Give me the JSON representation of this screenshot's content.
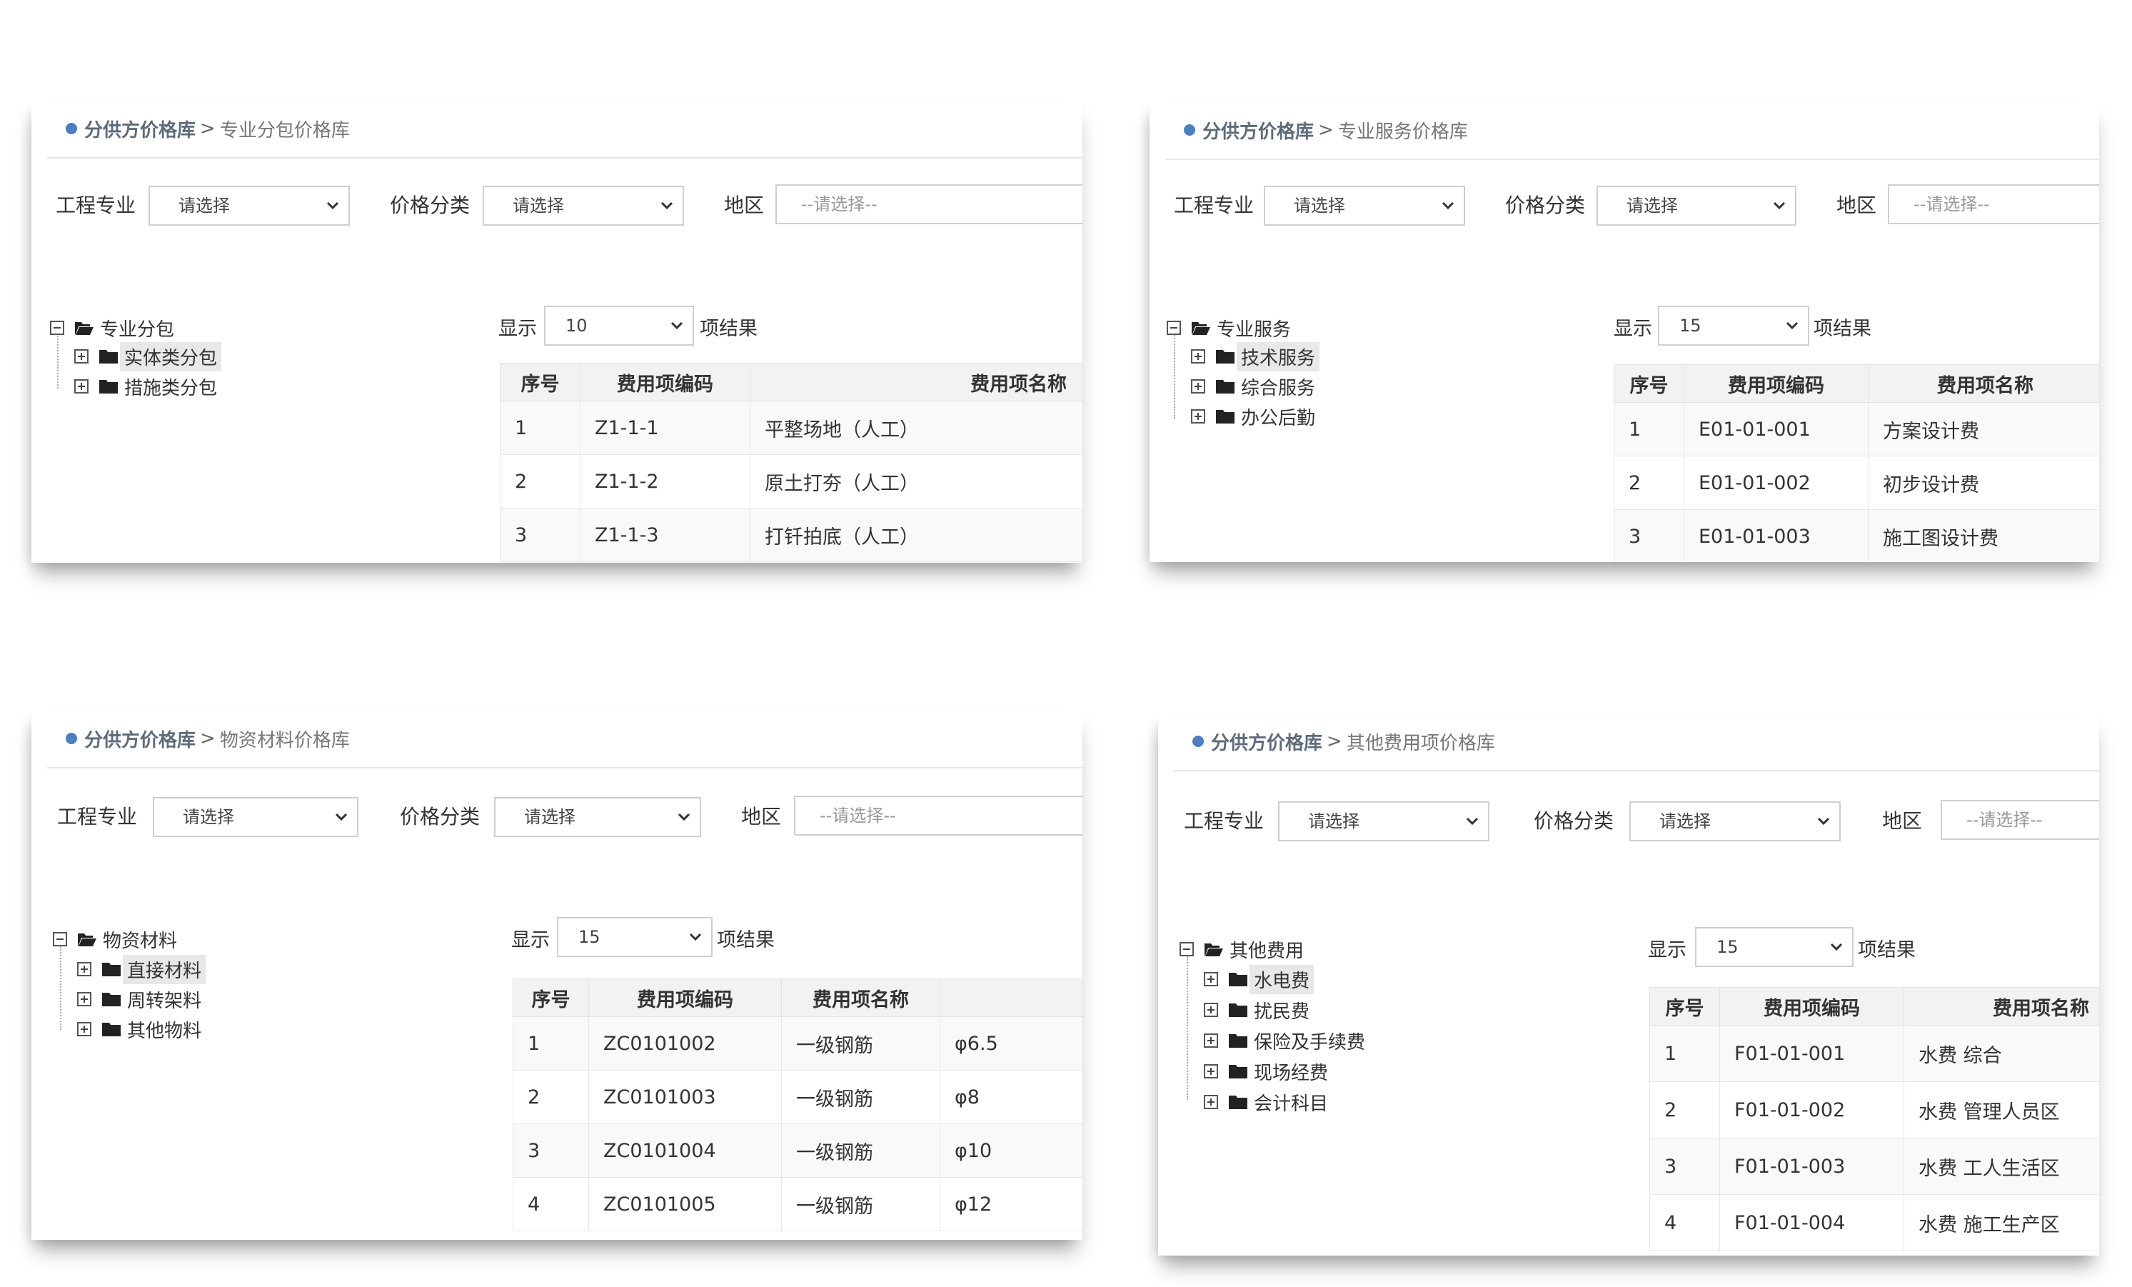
{
  "common": {
    "breadcrumb_root": "分供方价格库",
    "breadcrumb_sep": ">",
    "filter_label_profession": "工程专业",
    "filter_label_price_category": "价格分类",
    "filter_label_region": "地区",
    "select_placeholder": "请选择",
    "region_placeholder": "--请选择--",
    "show_label": "显示",
    "show_suffix": "项结果",
    "col_seq": "序号",
    "col_code": "费用项编码",
    "col_name": "费用项名称"
  },
  "panels": [
    {
      "breadcrumb_current": "专业分包价格库",
      "page_size": "10",
      "tree": {
        "root": "专业分包",
        "children": [
          "实体类分包",
          "措施类分包"
        ],
        "highlighted_index": 0
      },
      "rows": [
        {
          "seq": "1",
          "code": "Z1-1-1",
          "name": "平整场地（人工）"
        },
        {
          "seq": "2",
          "code": "Z1-1-2",
          "name": "原土打夯（人工）"
        },
        {
          "seq": "3",
          "code": "Z1-1-3",
          "name": "打钎拍底（人工）"
        }
      ]
    },
    {
      "breadcrumb_current": "专业服务价格库",
      "page_size": "15",
      "tree": {
        "root": "专业服务",
        "children": [
          "技术服务",
          "综合服务",
          "办公后勤"
        ],
        "highlighted_index": 0
      },
      "rows": [
        {
          "seq": "1",
          "code": "E01-01-001",
          "name": "方案设计费"
        },
        {
          "seq": "2",
          "code": "E01-01-002",
          "name": "初步设计费"
        },
        {
          "seq": "3",
          "code": "E01-01-003",
          "name": "施工图设计费"
        }
      ]
    },
    {
      "breadcrumb_current": "物资材料价格库",
      "page_size": "15",
      "tree": {
        "root": "物资材料",
        "children": [
          "直接材料",
          "周转架料",
          "其他物料"
        ],
        "highlighted_index": 0
      },
      "rows": [
        {
          "seq": "1",
          "code": "ZC0101002",
          "name": "一级钢筋",
          "spec": "φ6.5"
        },
        {
          "seq": "2",
          "code": "ZC0101003",
          "name": "一级钢筋",
          "spec": "φ8"
        },
        {
          "seq": "3",
          "code": "ZC0101004",
          "name": "一级钢筋",
          "spec": "φ10"
        },
        {
          "seq": "4",
          "code": "ZC0101005",
          "name": "一级钢筋",
          "spec": "φ12"
        }
      ]
    },
    {
      "breadcrumb_current": "其他费用项价格库",
      "page_size": "15",
      "tree": {
        "root": "其他费用",
        "children": [
          "水电费",
          "扰民费",
          "保险及手续费",
          "现场经费",
          "会计科目"
        ],
        "highlighted_index": 0
      },
      "rows": [
        {
          "seq": "1",
          "code": "F01-01-001",
          "name": "水费 综合"
        },
        {
          "seq": "2",
          "code": "F01-01-002",
          "name": "水费 管理人员区"
        },
        {
          "seq": "3",
          "code": "F01-01-003",
          "name": "水费 工人生活区"
        },
        {
          "seq": "4",
          "code": "F01-01-004",
          "name": "水费 施工生产区"
        }
      ]
    }
  ],
  "colors": {
    "breadcrumb_dot": "#4a7fc1",
    "header_bg": "#f2f2f2",
    "highlight_bg": "#e8e8e8"
  },
  "icons": [
    "chevron-down-icon",
    "folder-open-icon",
    "folder-icon",
    "expand-toggle-icon",
    "collapse-toggle-icon"
  ]
}
